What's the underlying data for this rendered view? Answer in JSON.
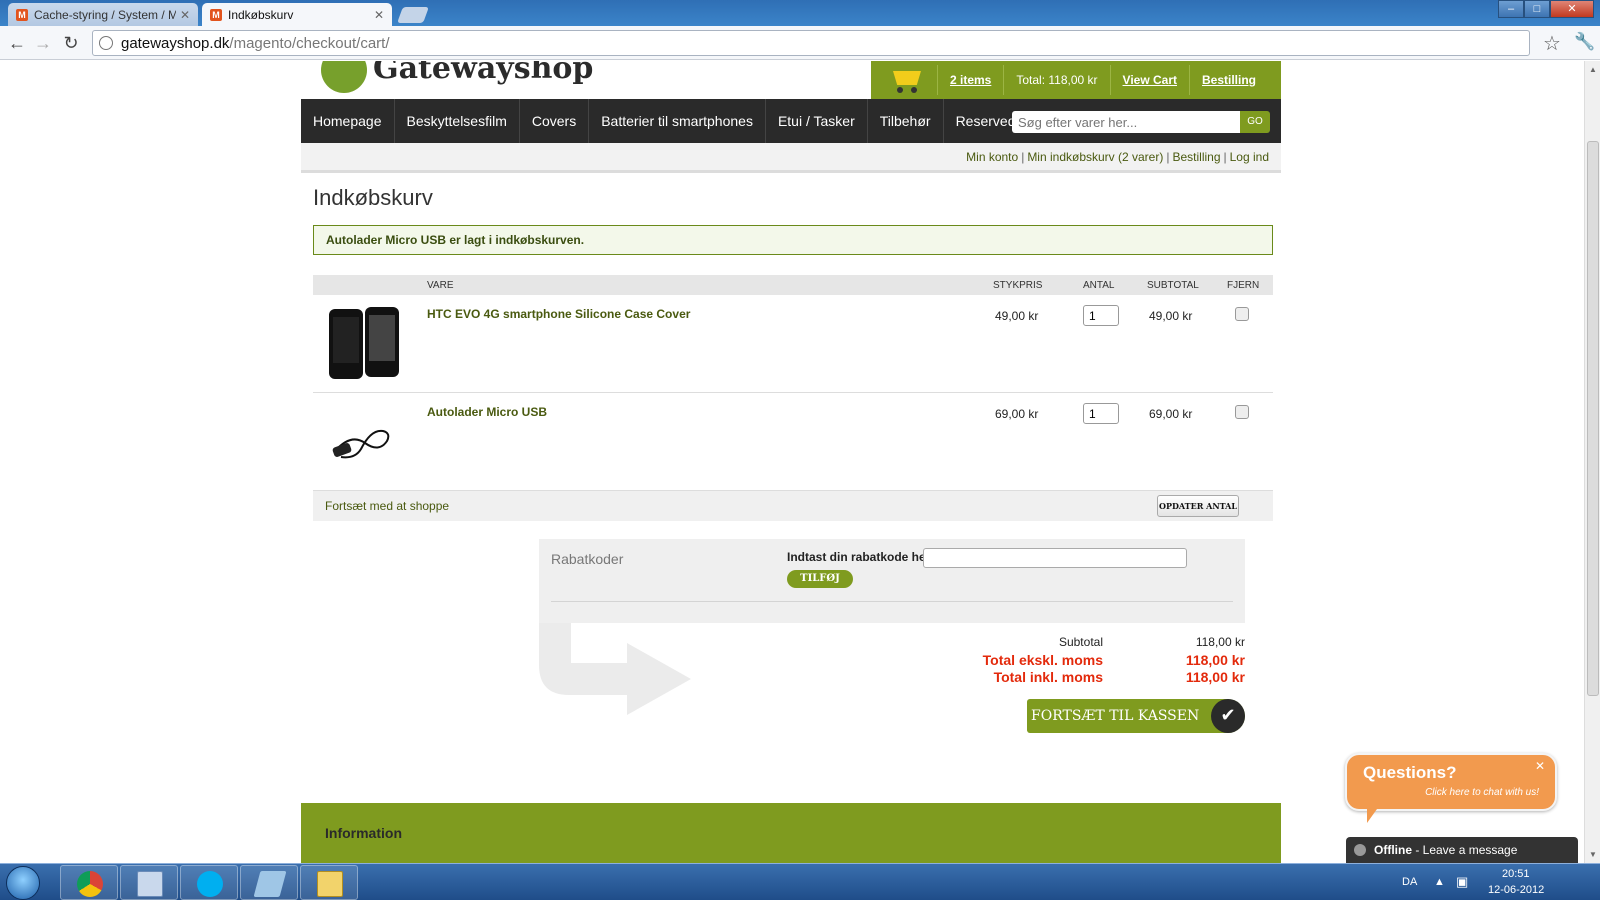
{
  "browser": {
    "tabs": [
      {
        "title": "Cache-styring / System / M",
        "active": false
      },
      {
        "title": "Indkøbskurv",
        "active": true
      }
    ],
    "url_host": "gatewayshop.dk",
    "url_path": "/magento/checkout/cart/"
  },
  "header": {
    "logo_text": "Gatewayshop",
    "cart_items_link": "2 items",
    "cart_total": "Total: 118,00 kr",
    "view_cart": "View Cart",
    "order_link": "Bestilling"
  },
  "nav": {
    "items": [
      "Homepage",
      "Beskyttelsesfilm",
      "Covers",
      "Batterier til smartphones",
      "Etui / Tasker",
      "Tilbehør",
      "Reservedele"
    ],
    "search_placeholder": "Søg efter varer her...",
    "search_button": "GO"
  },
  "toplinks": {
    "account": "Min konto",
    "cart": "Min indkøbskurv (2 varer)",
    "order": "Bestilling",
    "login": "Log ind"
  },
  "page": {
    "title": "Indkøbskurv",
    "success_message": "Autolader Micro USB er lagt i indkøbskurven."
  },
  "cart": {
    "columns": {
      "item": "VARE",
      "unit_price": "STYKPRIS",
      "qty": "ANTAL",
      "subtotal": "SUBTOTAL",
      "remove": "FJERN"
    },
    "items": [
      {
        "name": "HTC EVO 4G smartphone Silicone Case Cover",
        "price": "49,00 kr",
        "qty": "1",
        "subtotal": "49,00 kr"
      },
      {
        "name": "Autolader Micro USB",
        "price": "69,00 kr",
        "qty": "1",
        "subtotal": "69,00 kr"
      }
    ],
    "continue_shopping": "Fortsæt med at shoppe",
    "update_button": "OPDATER ANTAL"
  },
  "discount": {
    "title": "Rabatkoder",
    "label": "Indtast din rabatkode her.",
    "value": "",
    "button": "TILFØJ"
  },
  "totals": {
    "subtotal_label": "Subtotal",
    "subtotal_value": "118,00 kr",
    "excl_label": "Total ekskl. moms",
    "excl_value": "118,00 kr",
    "incl_label": "Total inkl. moms",
    "incl_value": "118,00 kr",
    "checkout_button": "FORTSÆT TIL KASSEN"
  },
  "footer": {
    "title": "Information"
  },
  "chat": {
    "bubble_title": "Questions?",
    "bubble_sub": "Click here to chat with us!",
    "status_bold": "Offline",
    "status_rest": " - Leave a message"
  },
  "taskbar": {
    "language": "DA",
    "time": "20:51",
    "date": "12-06-2012"
  },
  "colors": {
    "brand_green": "#7f9b1f",
    "nav_dark": "#2a2a2a",
    "total_red": "#e32a0c",
    "chat_orange": "#f29a4e"
  }
}
